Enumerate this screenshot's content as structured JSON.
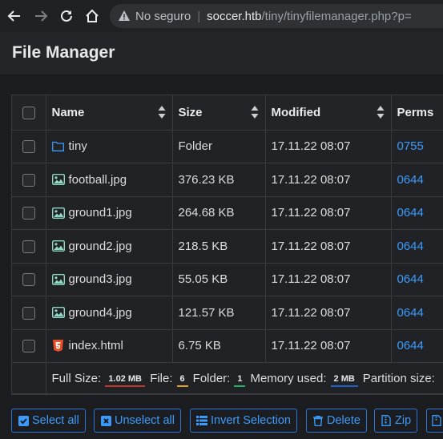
{
  "browser": {
    "not_secure": "No seguro",
    "url_host": "soccer.htb",
    "url_path": "/tiny/tinyfilemanager.php?p="
  },
  "app": {
    "title": "File Manager"
  },
  "table": {
    "headers": {
      "name": "Name",
      "size": "Size",
      "modified": "Modified",
      "perms": "Perms"
    },
    "rows": [
      {
        "name": "tiny",
        "size": "Folder",
        "modified": "17.11.22 08:07",
        "perms": "0755",
        "icon": "folder-icon"
      },
      {
        "name": "football.jpg",
        "size": "376.23 KB",
        "modified": "17.11.22 08:07",
        "perms": "0644",
        "icon": "image-file-icon"
      },
      {
        "name": "ground1.jpg",
        "size": "264.68 KB",
        "modified": "17.11.22 08:07",
        "perms": "0644",
        "icon": "image-file-icon"
      },
      {
        "name": "ground2.jpg",
        "size": "218.5 KB",
        "modified": "17.11.22 08:07",
        "perms": "0644",
        "icon": "image-file-icon"
      },
      {
        "name": "ground3.jpg",
        "size": "55.05 KB",
        "modified": "17.11.22 08:07",
        "perms": "0644",
        "icon": "image-file-icon"
      },
      {
        "name": "ground4.jpg",
        "size": "121.57 KB",
        "modified": "17.11.22 08:07",
        "perms": "0644",
        "icon": "image-file-icon"
      },
      {
        "name": "index.html",
        "size": "6.75 KB",
        "modified": "17.11.22 08:07",
        "perms": "0644",
        "icon": "html5-icon"
      }
    ],
    "footer": {
      "full_size_label": "Full Size:",
      "full_size_value": "1.02 MB",
      "file_label": "File:",
      "file_value": "6",
      "folder_label": "Folder:",
      "folder_value": "1",
      "memory_label": "Memory used:",
      "memory_value": "2 MB",
      "partition_label": "Partition size:"
    }
  },
  "actions": {
    "select_all": "Select all",
    "unselect_all": "Unselect all",
    "invert_selection": "Invert Selection",
    "delete": "Delete",
    "zip": "Zip"
  },
  "colors": {
    "accent": "#3a9bfd",
    "badge_size": "#c0392b",
    "badge_file": "#e6a019",
    "badge_folder": "#27ae60",
    "badge_memory": "#1f63c9",
    "html_icon": "#e44d26"
  }
}
